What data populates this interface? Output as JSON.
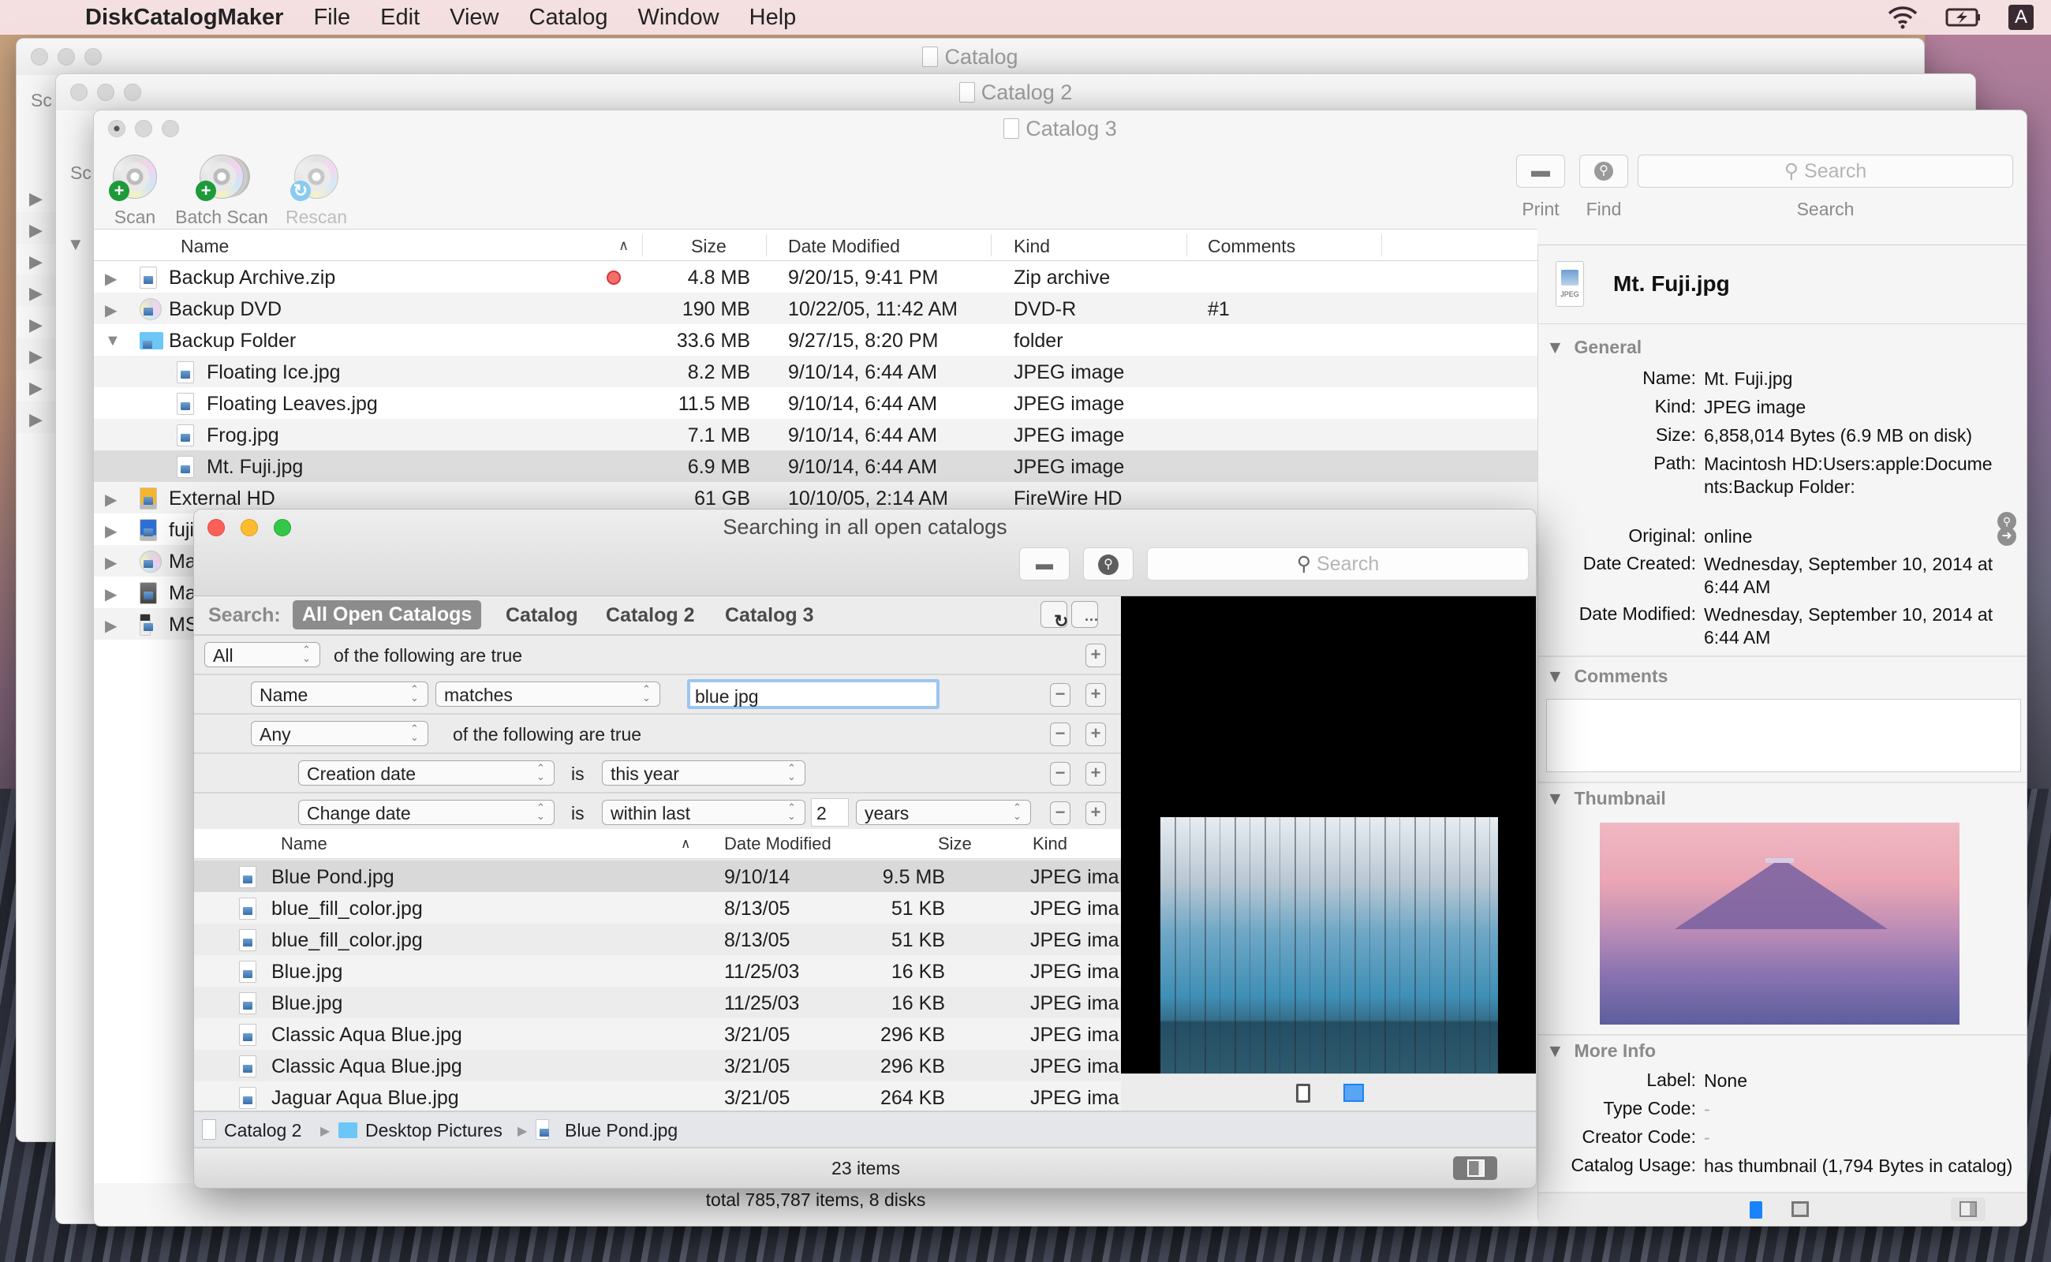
{
  "menubar": {
    "app_name": "DiskCatalogMaker",
    "items": [
      "File",
      "Edit",
      "View",
      "Catalog",
      "Window",
      "Help"
    ],
    "input_source": "A"
  },
  "windows": {
    "back1_title": "Catalog",
    "back2_title": "Catalog 2",
    "main_title": "Catalog 3",
    "back_scan_label": "Sc"
  },
  "toolbar": {
    "scan": "Scan",
    "batch_scan": "Batch Scan",
    "rescan": "Rescan",
    "print": "Print",
    "find": "Find",
    "search_label": "Search",
    "search_placeholder": "Search"
  },
  "catalog_table": {
    "columns": [
      "Name",
      "Size",
      "Date Modified",
      "Kind",
      "Comments"
    ],
    "rows": [
      {
        "name": "Backup Archive.zip",
        "size": "4.8 MB",
        "date": "9/20/15, 9:41 PM",
        "kind": "Zip archive",
        "comments": "",
        "label_color": "#f2706c",
        "expanded": false
      },
      {
        "name": "Backup DVD",
        "size": "190 MB",
        "date": "10/22/05, 11:42 AM",
        "kind": "DVD-R",
        "comments": "#1",
        "expanded": false
      },
      {
        "name": "Backup Folder",
        "size": "33.6 MB",
        "date": "9/27/15, 8:20 PM",
        "kind": "folder",
        "comments": "",
        "expanded": true
      },
      {
        "name": "Floating Ice.jpg",
        "size": "8.2 MB",
        "date": "9/10/14, 6:44 AM",
        "kind": "JPEG image",
        "comments": "",
        "child": true
      },
      {
        "name": "Floating Leaves.jpg",
        "size": "11.5 MB",
        "date": "9/10/14, 6:44 AM",
        "kind": "JPEG image",
        "comments": "",
        "child": true
      },
      {
        "name": "Frog.jpg",
        "size": "7.1 MB",
        "date": "9/10/14, 6:44 AM",
        "kind": "JPEG image",
        "comments": "",
        "child": true
      },
      {
        "name": "Mt. Fuji.jpg",
        "size": "6.9 MB",
        "date": "9/10/14, 6:44 AM",
        "kind": "JPEG image",
        "comments": "",
        "child": true,
        "selected": true
      },
      {
        "name": "External HD",
        "size": "61 GB",
        "date": "10/10/05, 2:14 AM",
        "kind": "FireWire HD",
        "comments": "",
        "expanded": false
      },
      {
        "name": "fuji",
        "expanded": false
      },
      {
        "name": "Ma",
        "expanded": false
      },
      {
        "name": "Ma",
        "expanded": false
      },
      {
        "name": "MS",
        "expanded": false
      }
    ],
    "status": "total 785,787 items, 8 disks"
  },
  "inspector": {
    "title": "Mt. Fuji.jpg",
    "icon_caption": "JPEG",
    "general_header": "General",
    "general": [
      {
        "key": "Name:",
        "value": "Mt. Fuji.jpg"
      },
      {
        "key": "Kind:",
        "value": "JPEG image"
      },
      {
        "key": "Size:",
        "value": "6,858,014 Bytes (6.9 MB on disk)"
      },
      {
        "key": "Path:",
        "value": "Macintosh HD:Users:apple:Documents:Backup Folder:"
      },
      {
        "key": "Original:",
        "value": "online"
      },
      {
        "key": "Date Created:",
        "value": "Wednesday, September 10, 2014 at 6:44 AM"
      },
      {
        "key": "Date Modified:",
        "value": "Wednesday, September 10, 2014 at 6:44 AM"
      }
    ],
    "comments_header": "Comments",
    "comments_value": "",
    "thumbnail_header": "Thumbnail",
    "more_info_header": "More Info",
    "more_info": [
      {
        "key": "Label:",
        "value": "None"
      },
      {
        "key": "Type Code:",
        "value": "-"
      },
      {
        "key": "Creator Code:",
        "value": "-"
      },
      {
        "key": "Catalog Usage:",
        "value": "has thumbnail (1,794 Bytes in catalog)"
      }
    ]
  },
  "search_window": {
    "title": "Searching in all open catalogs",
    "search_placeholder": "Search",
    "scope_label": "Search:",
    "scopes": [
      "All Open Catalogs",
      "Catalog",
      "Catalog 2",
      "Catalog 3"
    ],
    "active_scope": "All Open Catalogs",
    "criteria": {
      "root_match": "All",
      "root_text": "of the following are true",
      "name_field": "Name",
      "name_op": "matches",
      "name_value": "blue jpg",
      "group_match": "Any",
      "group_text": "of the following are true",
      "c1_field": "Creation date",
      "c1_is": "is",
      "c1_value": "this year",
      "c2_field": "Change date",
      "c2_is": "is",
      "c2_op": "within last",
      "c2_num": "2",
      "c2_unit": "years"
    },
    "results_columns": [
      "Name",
      "Date Modified",
      "Size",
      "Kind"
    ],
    "results": [
      {
        "name": "Blue Pond.jpg",
        "date": "9/10/14",
        "size": "9.5 MB",
        "kind": "JPEG ima",
        "selected": true
      },
      {
        "name": "blue_fill_color.jpg",
        "date": "8/13/05",
        "size": "51 KB",
        "kind": "JPEG ima"
      },
      {
        "name": "blue_fill_color.jpg",
        "date": "8/13/05",
        "size": "51 KB",
        "kind": "JPEG ima"
      },
      {
        "name": "Blue.jpg",
        "date": "11/25/03",
        "size": "16 KB",
        "kind": "JPEG ima"
      },
      {
        "name": "Blue.jpg",
        "date": "11/25/03",
        "size": "16 KB",
        "kind": "JPEG ima"
      },
      {
        "name": "Classic Aqua Blue.jpg",
        "date": "3/21/05",
        "size": "296 KB",
        "kind": "JPEG ima"
      },
      {
        "name": "Classic Aqua Blue.jpg",
        "date": "3/21/05",
        "size": "296 KB",
        "kind": "JPEG ima"
      },
      {
        "name": "Jaguar Aqua Blue.jpg",
        "date": "3/21/05",
        "size": "264 KB",
        "kind": "JPEG ima"
      }
    ],
    "path": [
      "Catalog 2",
      "Desktop Pictures",
      "Blue Pond.jpg"
    ],
    "status": "23 items"
  },
  "colors": {
    "accent_blue": "#1a82fb",
    "scope_active_bg": "#8c8c8c",
    "label_red": "#f2706c",
    "folder_blue": "#6cc6f6"
  }
}
